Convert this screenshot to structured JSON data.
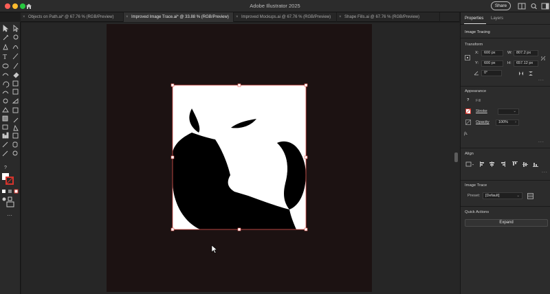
{
  "app": {
    "title": "Adobe Illustrator 2025",
    "share_label": "Share"
  },
  "tabs": [
    {
      "label": "Objects on Path.ai* @ 67.76 % (RGB/Preview)",
      "active": false
    },
    {
      "label": "Improved Image Trace.ai* @ 33.88 % (RGB/Preview)",
      "active": true
    },
    {
      "label": "Improved Mockups.ai @ 67.76 % (RGB/Preview)",
      "active": false
    },
    {
      "label": "Shape Fills.ai @ 67.76 % (RGB/Preview)",
      "active": false
    }
  ],
  "panel": {
    "tab_properties": "Properties",
    "tab_layers": "Layers",
    "selection_type": "Image Tracing",
    "transform": {
      "title": "Transform",
      "x_label": "X:",
      "x_value": "600 px",
      "y_label": "Y:",
      "y_value": "600 px",
      "w_label": "W:",
      "w_value": "807.2 px",
      "h_label": "H:",
      "h_value": "657.12 px",
      "angle_value": "0°"
    },
    "appearance": {
      "title": "Appearance",
      "fill_label": "Fill",
      "stroke_label": "Stroke",
      "opacity_label": "Opacity",
      "opacity_value": "100%",
      "fx_label": "fx."
    },
    "align": {
      "title": "Align"
    },
    "image_trace": {
      "title": "Image Trace",
      "preset_label": "Preset:",
      "preset_value": "[Default]"
    },
    "quick_actions": {
      "title": "Quick Actions",
      "expand_label": "Expand"
    }
  },
  "colors": {
    "artboard_bg": "#1c1212",
    "selection": "#e0554f",
    "accent_red": "#d6342c"
  }
}
